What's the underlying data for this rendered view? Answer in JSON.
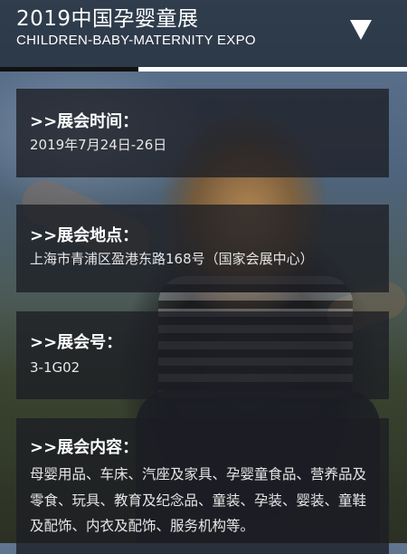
{
  "header": {
    "title": "2019中国孕婴童展",
    "subtitle": "CHILDREN-BABY-MATERNITY EXPO",
    "menu_icon": "triangle-down-icon"
  },
  "progress": {
    "fraction": 0.34
  },
  "sections": {
    "time": {
      "label": ">>展会时间：",
      "value": "2019年7月24日-26日"
    },
    "venue": {
      "label": ">>展会地点：",
      "value": "上海市青浦区盈港东路168号（国家会展中心）"
    },
    "booth": {
      "label": ">>展会号：",
      "value": "3-1G02"
    },
    "content": {
      "label": ">>展会内容：",
      "value": "母婴用品、车床、汽座及家具、孕婴童食品、营养品及零食、玩具、教育及纪念品、童装、孕装、婴装、童鞋及配饰、内衣及配饰、服务机构等。"
    }
  }
}
